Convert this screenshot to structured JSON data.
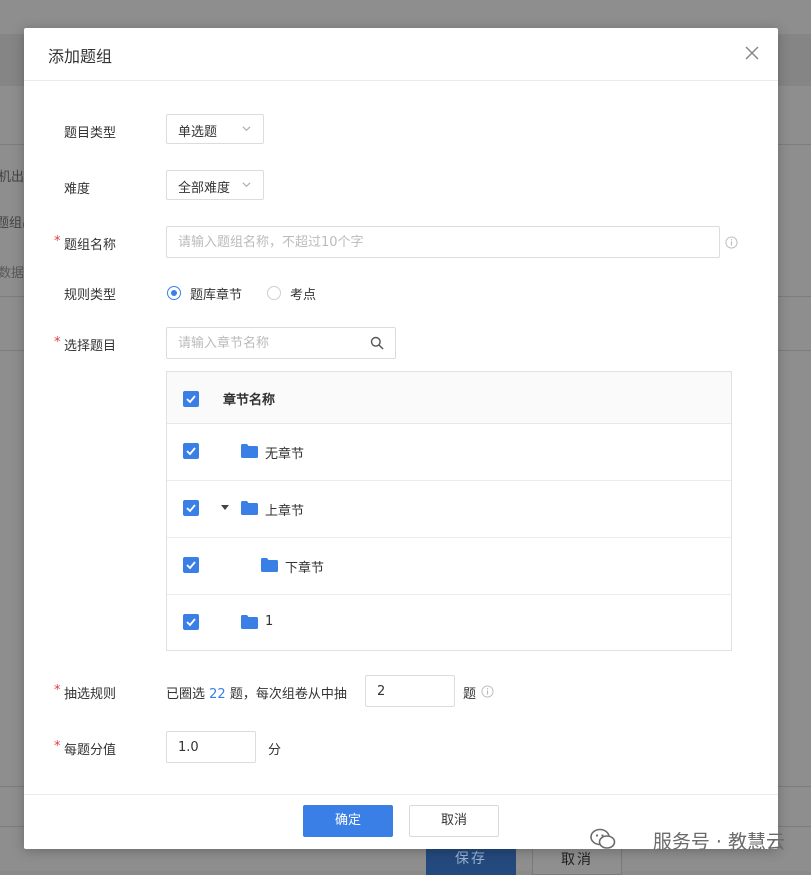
{
  "background": {
    "fragments": [
      "机出题",
      "题组出",
      "数据"
    ],
    "save_label": "保存",
    "cancel_label": "取消"
  },
  "dialog": {
    "title": "添加题组",
    "fields": {
      "question_type": {
        "label": "题目类型",
        "value": "单选题"
      },
      "difficulty": {
        "label": "难度",
        "value": "全部难度"
      },
      "group_name": {
        "label": "题组名称",
        "placeholder": "请输入题组名称，不超过10个字",
        "required_mark": "*"
      },
      "rule_type": {
        "label": "规则类型",
        "options": [
          {
            "label": "题库章节",
            "selected": true
          },
          {
            "label": "考点",
            "selected": false
          }
        ]
      },
      "select_questions": {
        "label": "选择题目",
        "required_mark": "*",
        "search_placeholder": "请输入章节名称"
      }
    },
    "tree": {
      "column_header": "章节名称",
      "rows": [
        {
          "label": "无章节",
          "checked": true,
          "level": 0,
          "expandable": false
        },
        {
          "label": "上章节",
          "checked": true,
          "level": 0,
          "expandable": true,
          "expanded": true
        },
        {
          "label": "下章节",
          "checked": true,
          "level": 1,
          "expandable": false
        },
        {
          "label": "1",
          "checked": true,
          "level": 0,
          "expandable": false
        }
      ],
      "header_checked": true
    },
    "draw_rule": {
      "label": "抽选规则",
      "required_mark": "*",
      "prefix": "已圈选",
      "selected_count": "22",
      "middle": "题，每次组卷从中抽",
      "draw_value": "2",
      "suffix": "题"
    },
    "score": {
      "label": "每题分值",
      "required_mark": "*",
      "value": "1.0",
      "unit": "分"
    },
    "footer": {
      "confirm_label": "确定",
      "cancel_label": "取消"
    }
  },
  "watermark": {
    "text": "服务号 · 教慧云"
  },
  "colors": {
    "primary": "#3a7fe6",
    "required": "#e23c39",
    "folder": "#3a7fe6"
  }
}
